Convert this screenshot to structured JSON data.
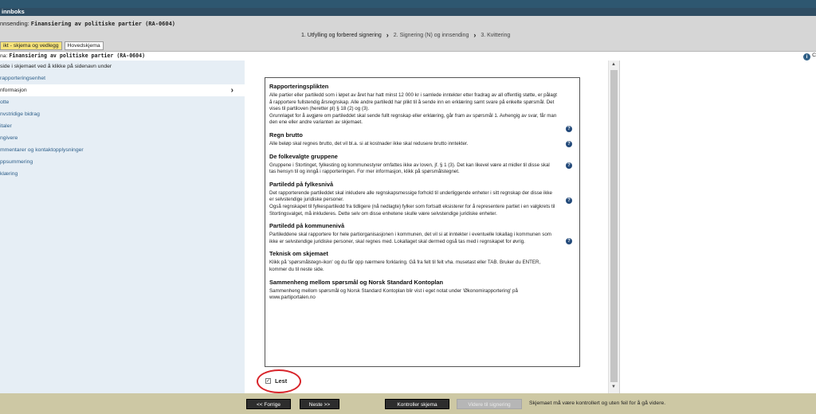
{
  "top_strip": {
    "title": "innboks"
  },
  "header": {
    "title_prefix": "nnsending: ",
    "title_main": "Finansiering av politiske partier (RA-0604)",
    "steps": [
      "1. Utfylling og forbered signering",
      "2. Signering (N) og innsending",
      "3. Kvittering"
    ],
    "tabs": [
      "ikt - skjema og vedlegg",
      "Hovedskjema"
    ]
  },
  "schema_line": {
    "prefix": "na: ",
    "name": "Finansiering av politiske partier (RA-0604)",
    "right_text": "C"
  },
  "sidebar": {
    "items": [
      "side i skjemaet ved å klikke på sidenavn under",
      "rapporteringsenhet",
      "nformasjon",
      "otte",
      "nvstridige bidrag",
      "italer",
      "ngivere",
      "mmentarer og kontaktopplysninger",
      "ppsummering",
      "klæring"
    ],
    "selected_index": 2
  },
  "info": {
    "sections": [
      {
        "title": "Rapporteringsplikten",
        "text": "Alle partier eller partiledd som i løpet av året har hatt minst 12 000 kr i samlede inntekter etter fradrag av all offentlig støtte, er pålagt å rapportere fullstendig årsregnskap. Alle andre partiledd har plikt til å sende inn en erklæring samt svare på enkelte spørsmål. Det vises til partiloven (heretter pl) § 18 (2) og (3).",
        "text2": "Grunnlaget for å avgjøre om partileddet skal sende fullt regnskap eller erklæring, går fram av spørsmål 1. Avhengig av svar, får man den ene eller andre varianten av skjemaet.",
        "help": true
      },
      {
        "title": "Regn brutto",
        "text": "Alle beløp skal regnes brutto, det vil bl.a. si at kostnader ikke skal redusere brutto inntekter.",
        "help": true
      },
      {
        "title": "De folkevalgte gruppene",
        "text": "Gruppene i Stortinget, fylkesting og kommunestyrer omfattes ikke av loven, jf. § 1 (3). Det kan likevel være at midler til disse skal tas hensyn til og inngå i rapporteringen. For mer informasjon, klikk på spørsmålstegnet.",
        "help": true
      },
      {
        "title": "Partiledd på fylkesnivå",
        "text": "Det rapporterende partileddet skal inkludere alle regnskapsmessige forhold til underliggende enheter i sitt regnskap der disse ikke er selvstendige juridiske personer.",
        "text2": "Også regnskapet til fylkespartiledd fra tidligere (nå nedlagte) fylker som fortsatt eksisterer for å representere partiet i en valgkrets til Stortingsvalget, må inkluderes. Dette selv om disse enhetene skulle være selvstendige juridiske enheter.",
        "help": true
      },
      {
        "title": "Partiledd på kommunenivå",
        "text": "Partileddene skal rapportere for hele partiorganisasjonen i kommunen, det vil si at inntekter i eventuelle lokallag i kommunen som ikke er selvstendige juridiske personer, skal regnes med. Lokallaget skal dermed også tas med i regnskapet for øvrig.",
        "help": true
      },
      {
        "title": "Teknisk om skjemaet",
        "text": "Klikk på 'spørsmålstegn-ikon' og du får opp nærmere forklaring. Gå fra felt til felt vha. musetast eller TAB. Bruker du ENTER, kommer du til neste side.",
        "help": false
      },
      {
        "title": "Sammenheng mellom spørsmål og Norsk Standard Kontoplan",
        "text": "Sammenheng mellom spørsmål og Norsk Standard Kontoplan blir vist i eget notat under 'Økonomirapportering' på www.partiportalen.no",
        "help": false
      }
    ]
  },
  "lest": {
    "label": "Lest",
    "checked": true
  },
  "footer": {
    "prev": "<< Forrige",
    "next": "Neste >>",
    "check": "Kontroller skjema",
    "forward": "Videre til signering",
    "message": "Skjemaet må være kontrollert og uten feil for å gå videre."
  },
  "colors": {
    "accent_dark": "#2f4d63",
    "link": "#2d5e89",
    "help_icon": "#234a7a",
    "highlight_ellipse": "#d8242a",
    "footer_bg": "#cdc8a4"
  }
}
